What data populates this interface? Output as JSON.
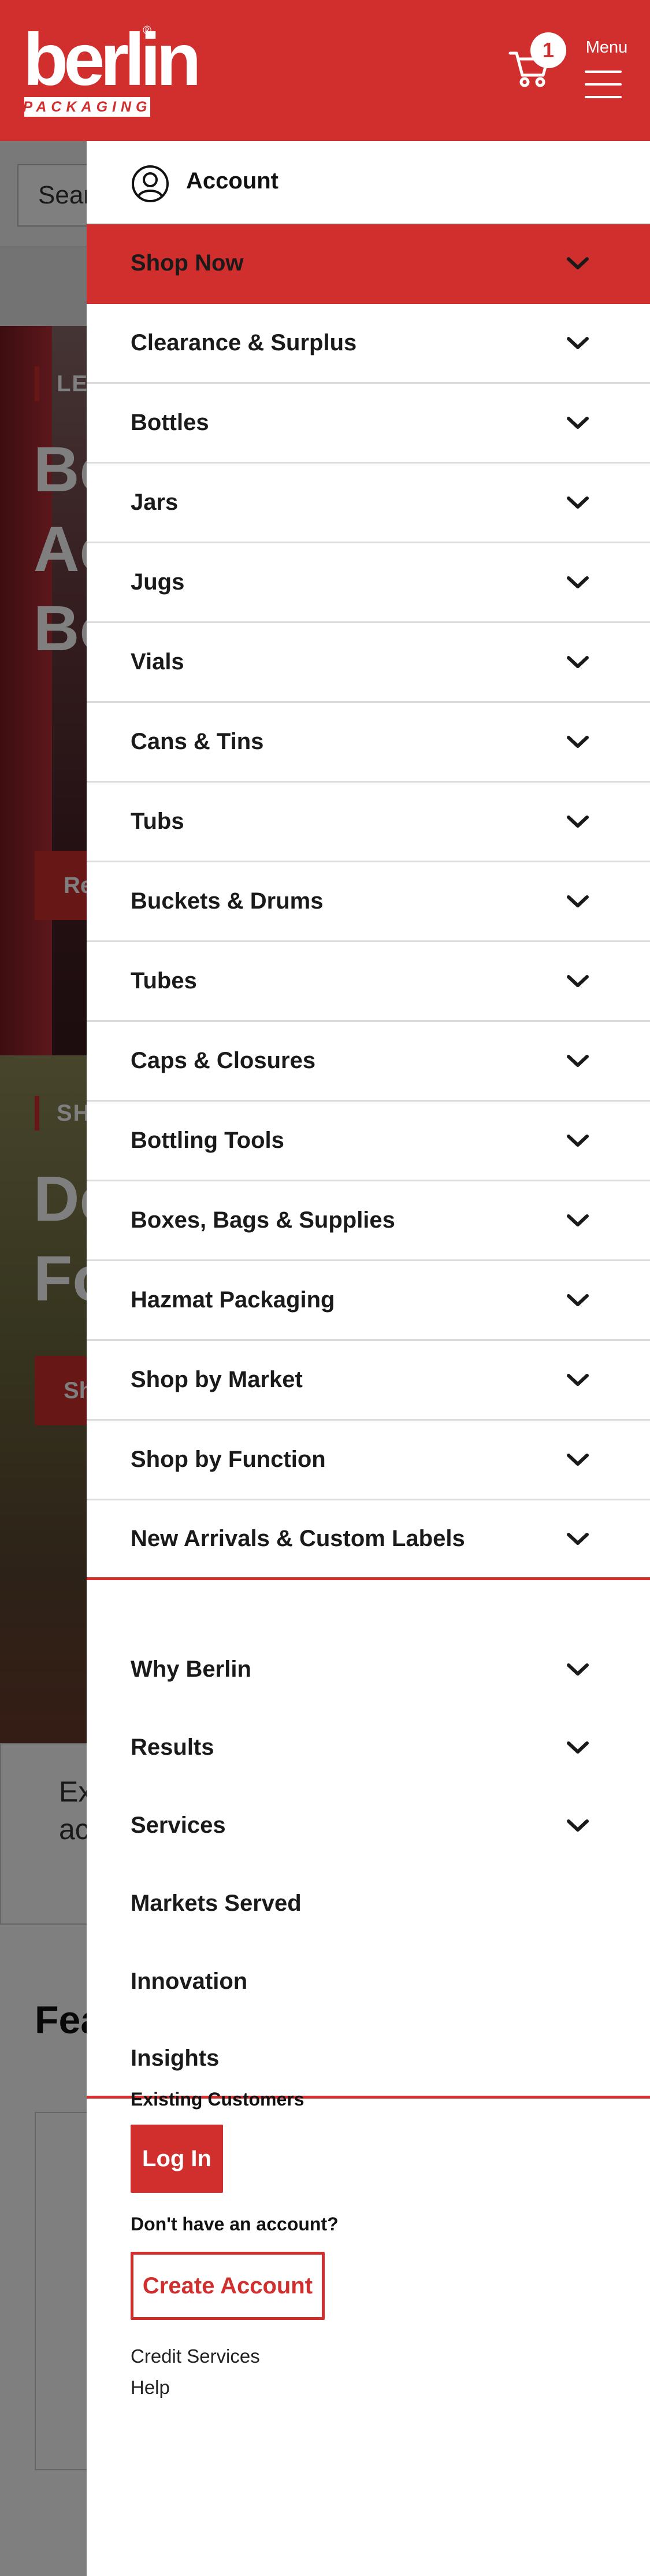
{
  "header": {
    "logo_word": "berlin",
    "logo_sub": "PACKAGING",
    "logo_reg": "®",
    "cart_count": "1",
    "menu_label": "Menu"
  },
  "background": {
    "search_placeholder": "Sear",
    "hero1_eyebrow": "LE",
    "hero1_heading": "Be\nAc\nBo",
    "hero1_cta": "Re",
    "hero2_eyebrow": "SH",
    "hero2_heading": "De\nFo",
    "hero2_cta": "Sh",
    "card_text": "Ex\nacr\n",
    "featured_heading": "Fea"
  },
  "drawer": {
    "account_label": "Account",
    "shop_items": [
      {
        "label": "Shop Now",
        "active": true
      },
      {
        "label": "Clearance & Surplus"
      },
      {
        "label": "Bottles"
      },
      {
        "label": "Jars"
      },
      {
        "label": "Jugs"
      },
      {
        "label": "Vials"
      },
      {
        "label": "Cans & Tins"
      },
      {
        "label": "Tubs"
      },
      {
        "label": "Buckets & Drums"
      },
      {
        "label": "Tubes"
      },
      {
        "label": "Caps & Closures"
      },
      {
        "label": "Bottling Tools"
      },
      {
        "label": "Boxes, Bags & Supplies"
      },
      {
        "label": "Hazmat Packaging"
      },
      {
        "label": "Shop by Market"
      },
      {
        "label": "Shop by Function"
      },
      {
        "label": "New Arrivals & Custom Labels"
      }
    ],
    "secondary_items": [
      {
        "label": "Why Berlin",
        "expandable": true
      },
      {
        "label": "Results",
        "expandable": true
      },
      {
        "label": "Services",
        "expandable": true
      },
      {
        "label": "Markets Served",
        "expandable": false
      },
      {
        "label": "Innovation",
        "expandable": false
      },
      {
        "label": "Insights",
        "expandable": false
      }
    ],
    "existing_customers_label": "Existing Customers",
    "login_label": "Log In",
    "no_account_label": "Don't have an account?",
    "create_account_label": "Create Account",
    "credit_services_label": "Credit Services",
    "help_label": "Help"
  },
  "colors": {
    "brand_red": "#d12f2e",
    "text_dark": "#1a1a1a",
    "divider": "#dcdcdc"
  },
  "icons": {
    "cart": "cart-icon",
    "menu": "hamburger-icon",
    "account": "user-circle-icon",
    "expand": "chevron-down-icon"
  }
}
